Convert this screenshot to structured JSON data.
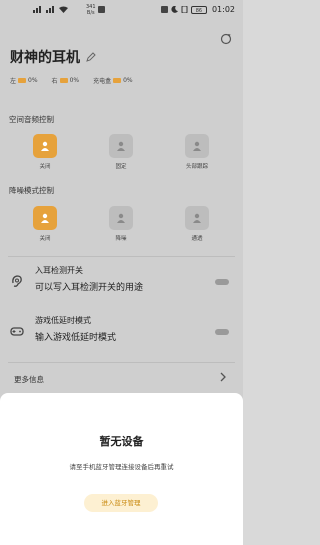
{
  "status_bar": {
    "net_speed_value": "341",
    "net_speed_unit": "B/s",
    "battery": "86",
    "time": "01:02"
  },
  "device": {
    "name": "财神的耳机"
  },
  "battery": {
    "left_label": "左",
    "left_value": "0%",
    "right_label": "右",
    "right_value": "0%",
    "case_label": "充电盒",
    "case_value": "0%"
  },
  "spatial_audio": {
    "label": "空间音频控制",
    "options": [
      {
        "label": "关闭"
      },
      {
        "label": "固定"
      },
      {
        "label": "头部跟踪"
      }
    ]
  },
  "noise_control": {
    "label": "降噪模式控制",
    "options": [
      {
        "label": "关闭"
      },
      {
        "label": "降噪"
      },
      {
        "label": "通透"
      }
    ]
  },
  "ear_detection": {
    "title": "入耳检测开关",
    "subtitle": "可以写入耳检测开关的用途"
  },
  "game_mode": {
    "title": "游戏低延时模式",
    "subtitle": "输入游戏低延时模式"
  },
  "more_info": {
    "label": "更多信息"
  },
  "sheet": {
    "title": "暂无设备",
    "message": "请至手机蓝牙管理连接设备后再重试",
    "button": "进入蓝牙管理"
  },
  "colors": {
    "accent": "#e6a23c",
    "overlay": "#cfcfcf",
    "sheet": "#ffffff"
  }
}
